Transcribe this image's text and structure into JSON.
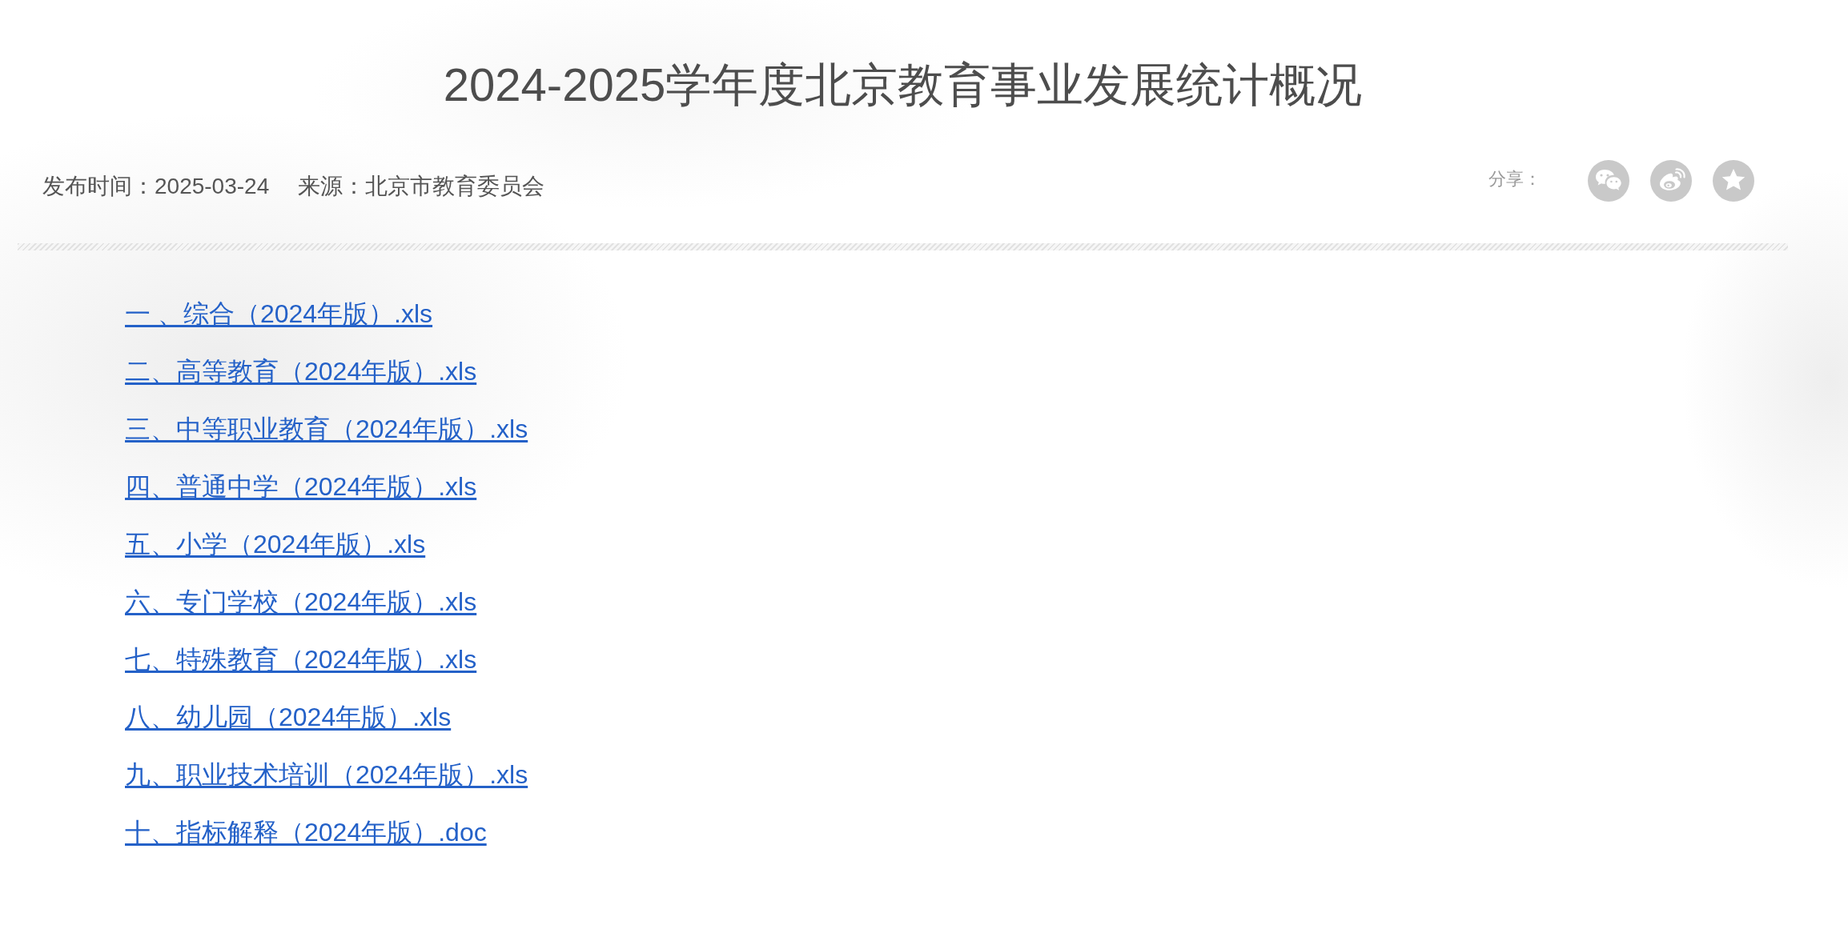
{
  "article": {
    "title": "2024-2025学年度北京教育事业发展统计概况",
    "meta": {
      "published": "发布时间：2025-03-24",
      "source": "来源：北京市教育委员会"
    },
    "share": {
      "label": "分享：",
      "buttons": [
        {
          "kind": "chat"
        },
        {
          "kind": "swirl"
        },
        {
          "kind": "star"
        }
      ]
    },
    "attachments": [
      {
        "label": "一 、综合（2024年版）.xls"
      },
      {
        "label": "二、高等教育（2024年版）.xls"
      },
      {
        "label": "三、中等职业教育（2024年版）.xls"
      },
      {
        "label": "四、普通中学（2024年版）.xls"
      },
      {
        "label": "五、小学（2024年版）.xls"
      },
      {
        "label": "六、专门学校（2024年版）.xls"
      },
      {
        "label": "七、特殊教育（2024年版）.xls"
      },
      {
        "label": "八、幼儿园（2024年版）.xls"
      },
      {
        "label": "九、职业技术培训（2024年版）.xls"
      },
      {
        "label": "十、指标解释（2024年版）.doc"
      }
    ]
  }
}
